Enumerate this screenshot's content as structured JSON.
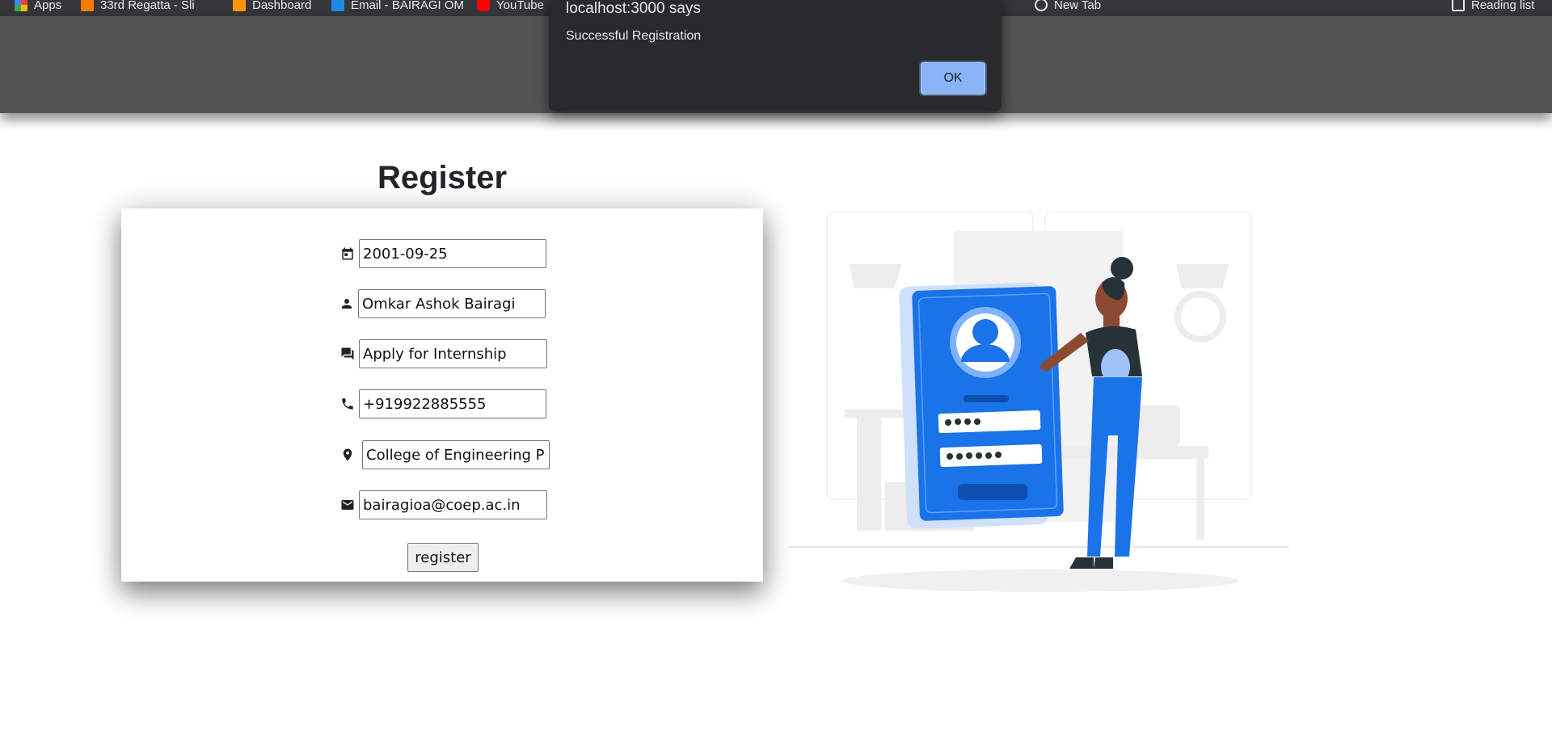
{
  "browser": {
    "bookmarks": [
      {
        "label": "Apps",
        "icon": "apps-grid-icon"
      },
      {
        "label": "33rd Regatta - Sli",
        "icon": "bookmark-favicon-icon"
      },
      {
        "label": "Dashboard",
        "icon": "dashboard-favicon-icon"
      },
      {
        "label": "Email - BAIRAGI OM",
        "icon": "mail-favicon-icon"
      },
      {
        "label": "YouTube",
        "icon": "youtube-icon"
      },
      {
        "label": "New Tab",
        "icon": "new-tab-icon"
      },
      {
        "label": "Reading list",
        "icon": "reading-list-icon"
      }
    ]
  },
  "dialog": {
    "title": "localhost:3000 says",
    "message": "Successful Registration",
    "ok_label": "OK"
  },
  "page": {
    "title": "Register"
  },
  "form": {
    "dob": {
      "value": "2001-09-25",
      "icon": "calendar-icon"
    },
    "name": {
      "value": "Omkar Ashok Bairagi",
      "icon": "person-icon"
    },
    "purpose": {
      "value": "Apply for Internship",
      "icon": "chat-icon"
    },
    "phone": {
      "value": "+919922885555",
      "icon": "phone-icon"
    },
    "address": {
      "value": "College of Engineering Pune",
      "icon": "location-pin-icon"
    },
    "email": {
      "value": "bairagioa@coep.ac.in",
      "icon": "mail-icon"
    },
    "submit_label": "register"
  },
  "colors": {
    "dialog_bg": "#292a2d",
    "ok_button": "#8ab4f8",
    "navbar_dimmed": "#545454",
    "illustration_accent": "#1a73e8"
  }
}
